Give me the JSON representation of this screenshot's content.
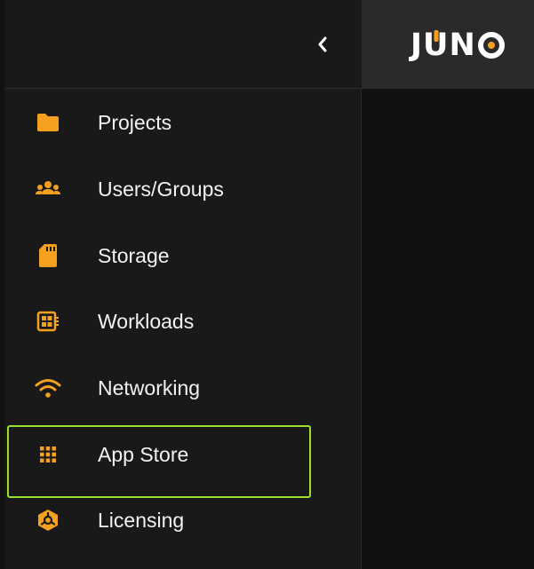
{
  "header": {
    "logo_text": "JUNO",
    "collapse_icon": "chevron-left-icon"
  },
  "colors": {
    "accent": "#f5a11f",
    "highlight": "#9be22d",
    "sidebar_bg": "#191919",
    "topbar_bg": "#2a2a2a"
  },
  "sidebar": {
    "items": [
      {
        "label": "Projects",
        "icon": "folder-icon"
      },
      {
        "label": "Users/Groups",
        "icon": "users-group-icon"
      },
      {
        "label": "Storage",
        "icon": "sd-card-icon"
      },
      {
        "label": "Workloads",
        "icon": "workloads-icon"
      },
      {
        "label": "Networking",
        "icon": "wifi-icon"
      },
      {
        "label": "App Store",
        "icon": "app-grid-icon",
        "selected": true
      },
      {
        "label": "Licensing",
        "icon": "license-box-icon"
      }
    ]
  }
}
